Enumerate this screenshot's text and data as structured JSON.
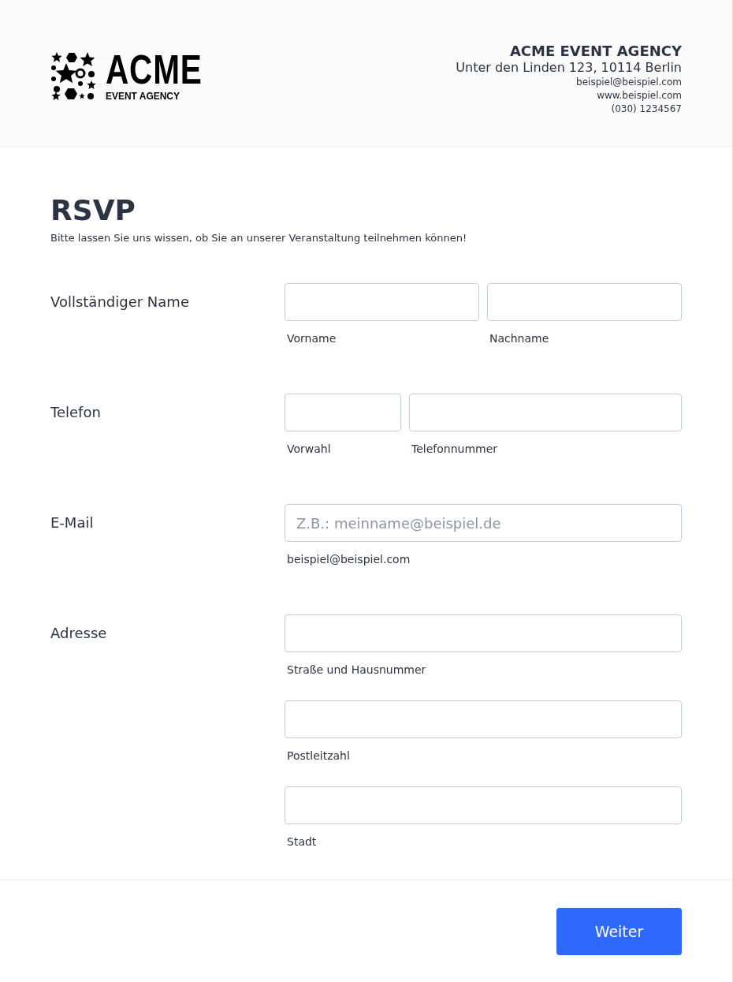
{
  "header": {
    "logo": {
      "wordmark": "ACME",
      "tagline": "EVENT AGENCY"
    },
    "company": {
      "name": "ACME EVENT AGENCY",
      "address": "Unter den Linden 123, 10114 Berlin",
      "email": "beispiel@beispiel.com",
      "website": "www.beispiel.com",
      "phone": "(030) 1234567"
    }
  },
  "form": {
    "title": "RSVP",
    "subtitle": "Bitte lassen Sie uns wissen, ob Sie an unserer Veranstaltung teilnehmen können!",
    "rows": [
      {
        "label": "Vollständiger Name",
        "kind": "inline",
        "fields": [
          {
            "kind": "half",
            "sublabel": "Vorname"
          },
          {
            "kind": "half",
            "sublabel": "Nachname"
          }
        ]
      },
      {
        "label": "Telefon",
        "kind": "inline",
        "fields": [
          {
            "kind": "narrow",
            "sublabel": "Vorwahl"
          },
          {
            "kind": "wide",
            "sublabel": "Telefonnummer"
          }
        ]
      },
      {
        "label": "E-Mail",
        "kind": "inline",
        "fields": [
          {
            "kind": "full",
            "placeholder": "Z.B.: meinname@beispiel.de",
            "sublabel": "beispiel@beispiel.com"
          }
        ]
      },
      {
        "label": "Adresse",
        "kind": "stacked",
        "fields": [
          {
            "kind": "full",
            "sublabel": "Straße und Hausnummer"
          },
          {
            "kind": "full",
            "sublabel": "Postleitzahl"
          },
          {
            "kind": "full",
            "sublabel": "Stadt"
          }
        ]
      }
    ]
  },
  "footer": {
    "button": "Weiter"
  }
}
